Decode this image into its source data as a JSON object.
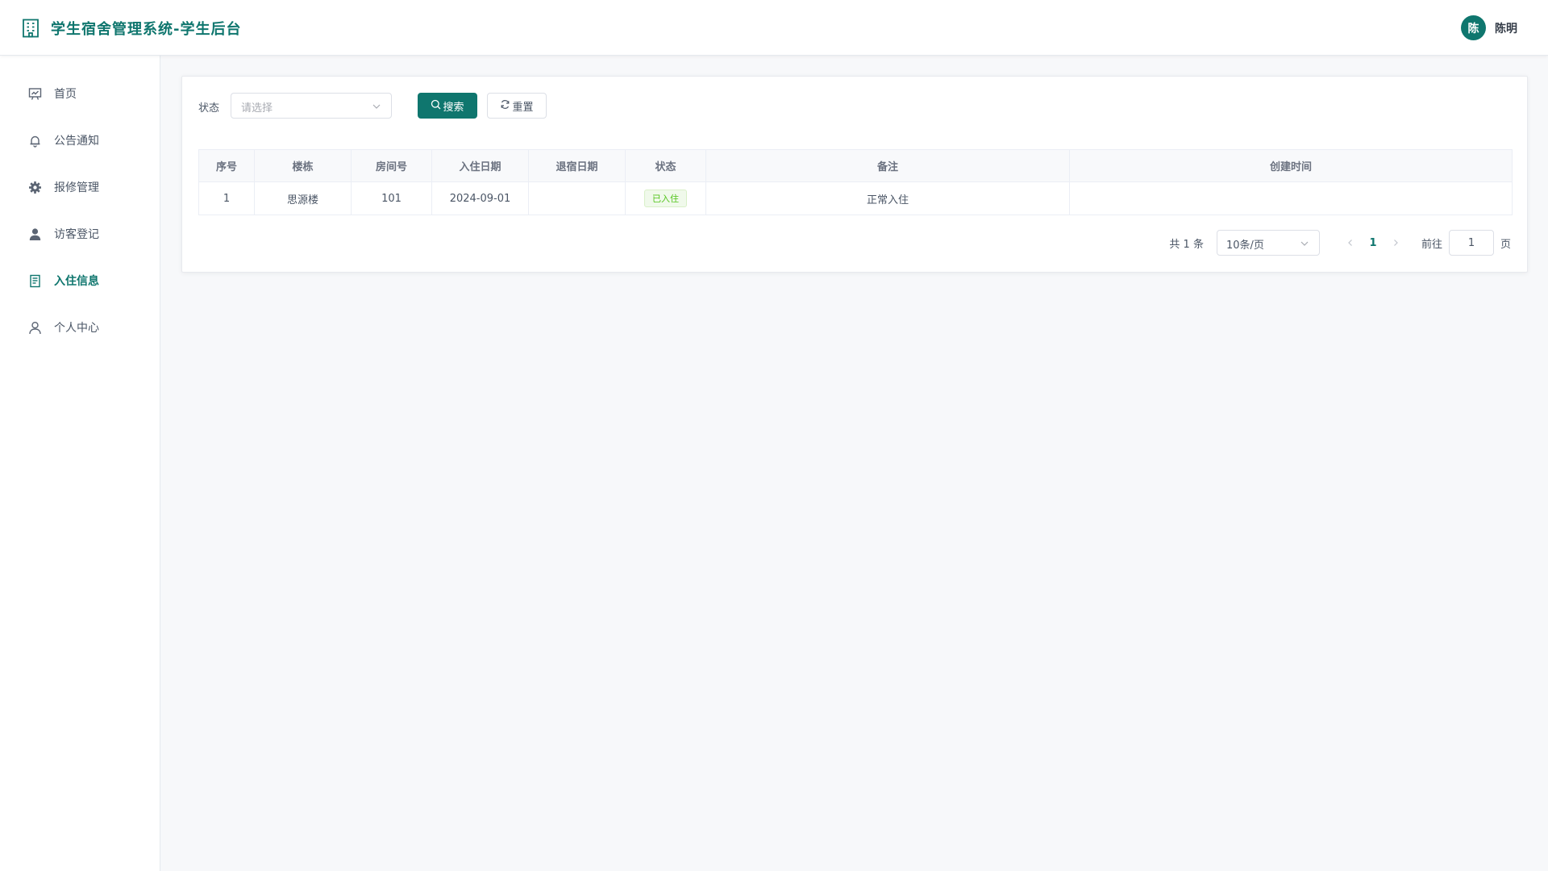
{
  "header": {
    "title": "学生宿舍管理系统-学生后台",
    "avatar_text": "陈",
    "username": "陈明",
    "accent_color": "#0f766e"
  },
  "sidebar": {
    "items": [
      {
        "label": "首页",
        "icon": "presentation-icon"
      },
      {
        "label": "公告通知",
        "icon": "bell-icon"
      },
      {
        "label": "报修管理",
        "icon": "gear-icon"
      },
      {
        "label": "访客登记",
        "icon": "user-filled-icon"
      },
      {
        "label": "入住信息",
        "icon": "document-icon",
        "active": true
      },
      {
        "label": "个人中心",
        "icon": "user-outline-icon"
      }
    ]
  },
  "filter": {
    "status_label": "状态",
    "status_placeholder": "请选择",
    "search_label": "搜索",
    "reset_label": "重置"
  },
  "table": {
    "columns": [
      "序号",
      "楼栋",
      "房间号",
      "入住日期",
      "退宿日期",
      "状态",
      "备注",
      "创建时间"
    ],
    "rows": [
      {
        "index": "1",
        "building": "思源楼",
        "room": "101",
        "checkin_date": "2024-09-01",
        "checkout_date": "",
        "status": "已入住",
        "remark": "正常入住",
        "created_at": ""
      }
    ]
  },
  "pagination": {
    "total_text": "共 1 条",
    "page_size": "10条/页",
    "current_page": "1",
    "goto_label": "前往",
    "goto_value": "1",
    "page_suffix": "页"
  }
}
